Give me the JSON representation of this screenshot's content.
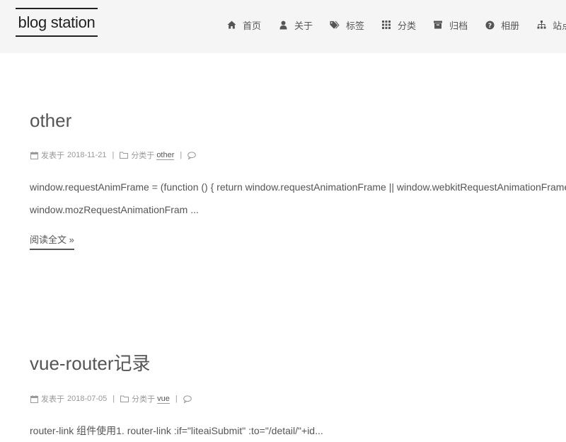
{
  "site": {
    "title": "blog station"
  },
  "nav": {
    "items": [
      {
        "label": "首页",
        "icon": "home-icon"
      },
      {
        "label": "关于",
        "icon": "user-icon"
      },
      {
        "label": "标签",
        "icon": "tags-icon"
      },
      {
        "label": "分类",
        "icon": "grid-icon"
      },
      {
        "label": "归档",
        "icon": "archive-icon"
      },
      {
        "label": "相册",
        "icon": "question-circle-icon"
      },
      {
        "label": "站点",
        "icon": "sitemap-icon"
      }
    ]
  },
  "posts": [
    {
      "title": "other",
      "posted_prefix": "发表于",
      "date": "2018-11-21",
      "category_prefix": "分类于",
      "category": "other",
      "separator": "|",
      "excerpt_line1": "window.requestAnimFrame = (function () { return window.requestAnimationFrame || window.webkitRequestAnimationFrame ||",
      "excerpt_line2": "window.mozRequestAnimationFram ...",
      "read_more": "阅读全文 »"
    },
    {
      "title": "vue-router记录",
      "posted_prefix": "发表于",
      "date": "2018-07-05",
      "category_prefix": "分类于",
      "category": "vue",
      "separator": "|",
      "excerpt_line1": "router-link 组件使用1. router-link :if=\"liteaiSubmit\" :to=\"/detail/\"+id..."
    }
  ],
  "colors": {
    "header_bg": "#f5f5f5",
    "text": "#555555",
    "meta": "#999999"
  }
}
